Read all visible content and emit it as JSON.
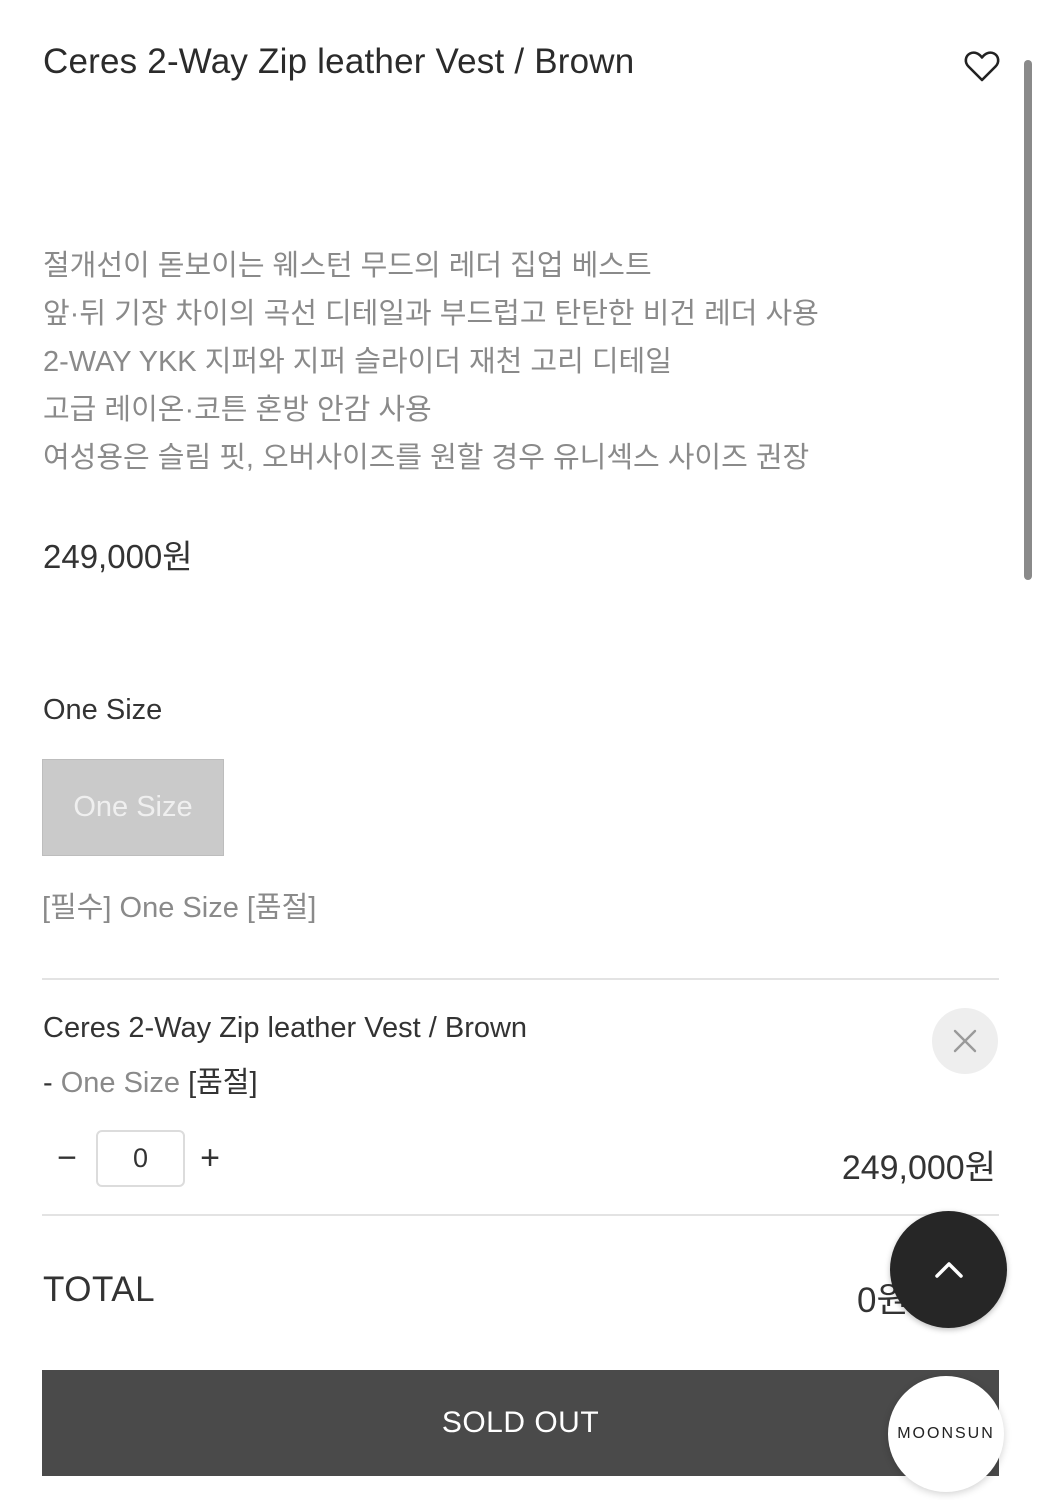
{
  "product": {
    "title": "Ceres 2-Way Zip leather Vest / Brown",
    "description": [
      "절개선이 돋보이는 웨스턴 무드의 레더 집업 베스트",
      "앞·뒤 기장 차이의 곡선 디테일과 부드럽고 탄탄한 비건 레더 사용",
      "2-WAY YKK 지퍼와 지퍼 슬라이더 재천 고리 디테일",
      "고급 레이온·코튼 혼방 안감 사용",
      "여성용은 슬림 핏, 오버사이즈를 원할 경우 유니섹스 사이즈 권장"
    ],
    "price": "249,000원"
  },
  "option": {
    "label": "One Size",
    "button_label": "One Size",
    "required_text": "[필수] One Size [품절]"
  },
  "selected_item": {
    "name": "Ceres 2-Way Zip leather Vest / Brown",
    "dash": "- ",
    "option_name": "One Size",
    "soldout_tag": " [품절]",
    "quantity": "0",
    "minus_label": "−",
    "plus_label": "+",
    "price": "249,000원"
  },
  "total": {
    "label": "TOTAL",
    "value": "0원"
  },
  "actions": {
    "soldout_label": "SOLD OUT"
  },
  "floating": {
    "brand_label": "MOONSUN"
  },
  "icons": {
    "wishlist": "heart-icon",
    "remove": "close-icon",
    "scroll_top": "chevron-up-icon"
  },
  "colors": {
    "soldout_button": "#4a4a4a",
    "option_disabled": "#cacaca",
    "top_button": "#262626"
  }
}
